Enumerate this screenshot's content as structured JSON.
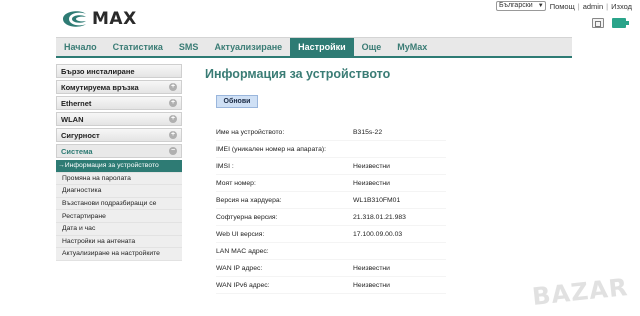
{
  "brand": {
    "logo_text": "MAX"
  },
  "toplinks": {
    "language": "Български",
    "help": "Помощ",
    "user": "admin",
    "logout": "Изход"
  },
  "nav": {
    "tabs": [
      {
        "label": "Начало"
      },
      {
        "label": "Статистика"
      },
      {
        "label": "SMS"
      },
      {
        "label": "Актуализиране"
      },
      {
        "label": "Настройки",
        "active": true
      },
      {
        "label": "Още"
      },
      {
        "label": "MyMax"
      }
    ]
  },
  "sidebar": {
    "items": [
      {
        "label": "Бързо инсталиране"
      },
      {
        "label": "Комутируема връзка"
      },
      {
        "label": "Ethernet"
      },
      {
        "label": "WLAN"
      },
      {
        "label": "Сигурност"
      },
      {
        "label": "Система"
      }
    ],
    "subitems": [
      {
        "label": "→Информация за устройството",
        "active": true
      },
      {
        "label": "Промяна на паролата"
      },
      {
        "label": "Диагностика"
      },
      {
        "label": "Възстанови подразбиращи се"
      },
      {
        "label": "Рестартиране"
      },
      {
        "label": "Дата и час"
      },
      {
        "label": "Настройки на антената"
      },
      {
        "label": "Актуализиране на настройките"
      }
    ]
  },
  "main": {
    "title": "Информация за устройството",
    "refresh_label": "Обнови",
    "rows": [
      {
        "label": "Име на устройството:",
        "value": "B315s-22"
      },
      {
        "label": "IMEI (уникален номер на апарата):",
        "value": ""
      },
      {
        "label": "IMSI :",
        "value": "Неизвестни"
      },
      {
        "label": "Моят номер:",
        "value": "Неизвестни"
      },
      {
        "label": "Версия на хардуера:",
        "value": "WL1B310FM01"
      },
      {
        "label": "Софтуерна версия:",
        "value": "21.318.01.21.983"
      },
      {
        "label": "Web UI версия:",
        "value": "17.100.09.00.03"
      },
      {
        "label": "LAN MAC адрес:",
        "value": ""
      },
      {
        "label": "WAN IP адрес:",
        "value": "Неизвестни"
      },
      {
        "label": "WAN IPv6 адрес:",
        "value": "Неизвестни"
      }
    ]
  },
  "watermark": "BAZAR",
  "colors": {
    "accent": "#2e7b74",
    "title": "#3a7c75",
    "button": "#cfe0f5"
  }
}
